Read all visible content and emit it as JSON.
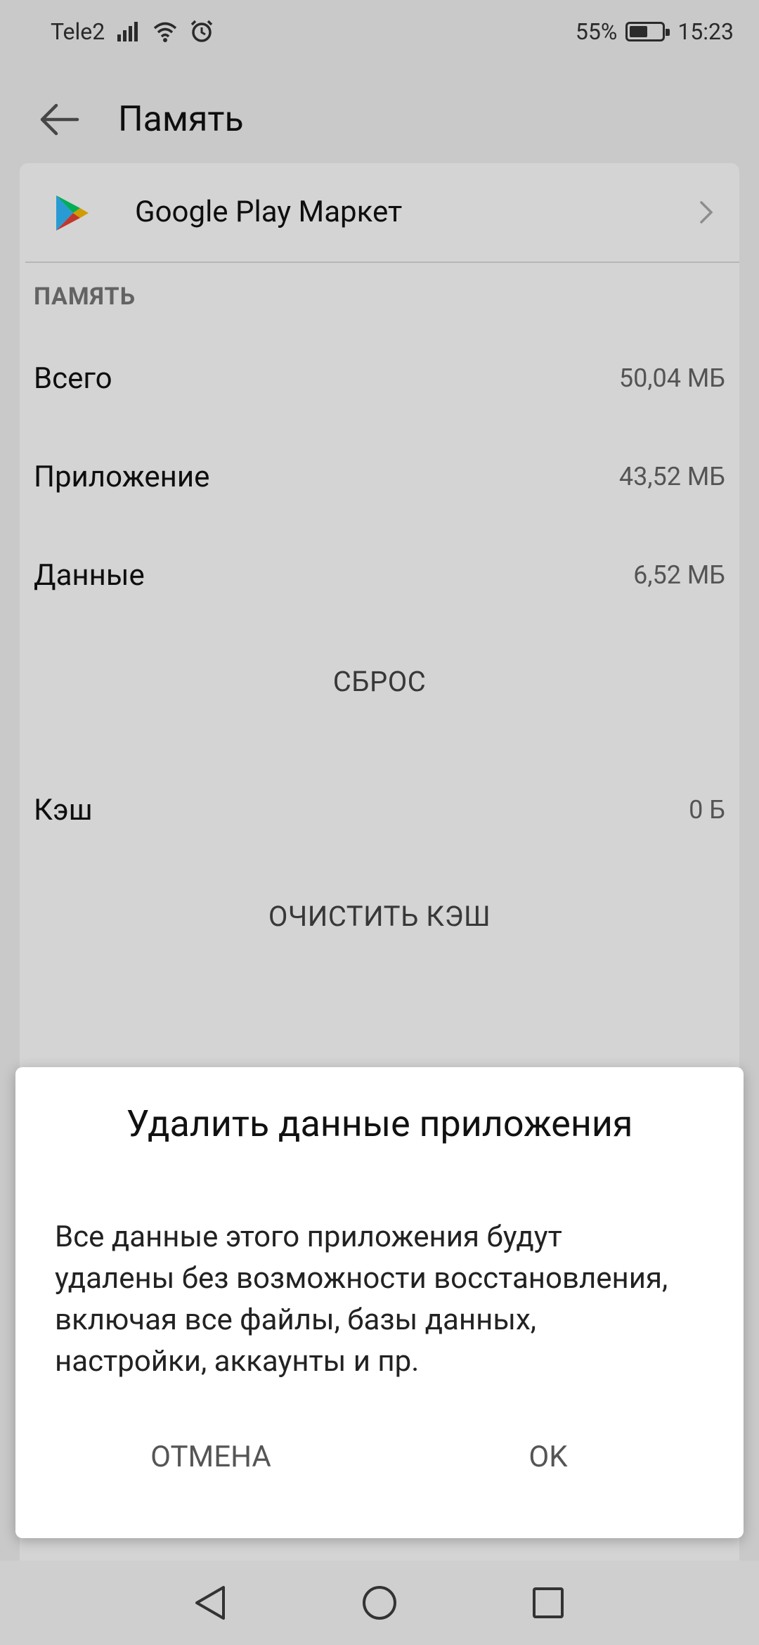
{
  "status_bar": {
    "carrier": "Tele2",
    "battery_percent": "55%",
    "battery_level": 0.55,
    "time": "15:23",
    "icons": [
      "signal-icon",
      "wifi-icon",
      "alarm-icon",
      "battery-icon"
    ]
  },
  "header": {
    "title": "Память",
    "back_icon": "arrow-left-icon"
  },
  "app": {
    "name": "Google Play Маркет",
    "icon": "google-play-icon"
  },
  "storage": {
    "section_title": "ПАМЯТЬ",
    "rows": [
      {
        "label": "Всего",
        "value": "50,04 МБ"
      },
      {
        "label": "Приложение",
        "value": "43,52 МБ"
      },
      {
        "label": "Данные",
        "value": "6,52 МБ"
      }
    ],
    "reset_label": "СБРОС",
    "cache": {
      "label": "Кэш",
      "value": "0 Б"
    },
    "clear_cache_label": "ОЧИСТИТЬ КЭШ"
  },
  "dialog": {
    "title": "Удалить данные приложения",
    "message": "Все данные этого приложения будут удалены без возможности восстановления, включая все файлы, базы данных, настройки, аккаунты и пр.",
    "cancel_label": "ОТМЕНА",
    "ok_label": "OK"
  },
  "navigation": {
    "icons": [
      "back-triangle-icon",
      "home-circle-icon",
      "recents-square-icon"
    ]
  },
  "colors": {
    "page_background": "#f2f2f2",
    "card_background": "#ffffff",
    "nav_bar": "#cfcfcf",
    "scrim": "rgba(0,0,0,0.17)"
  }
}
